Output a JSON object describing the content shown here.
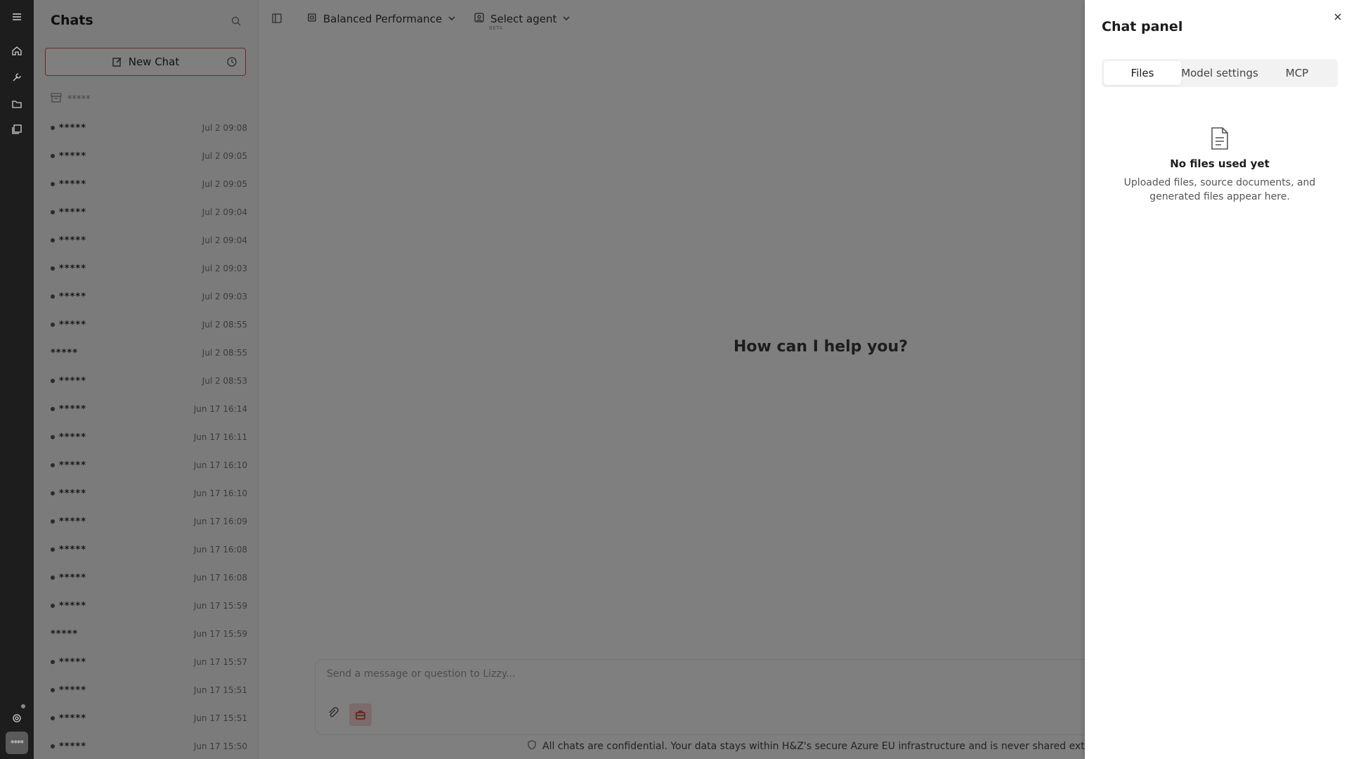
{
  "sidebar": {
    "title": "Chats",
    "new_chat_label": "New Chat",
    "archive_label": "*****",
    "chats": [
      {
        "name": "*****",
        "time": "Jul 2 09:08",
        "bullet": true
      },
      {
        "name": "*****",
        "time": "Jul 2 09:05",
        "bullet": true
      },
      {
        "name": "*****",
        "time": "Jul 2 09:05",
        "bullet": true
      },
      {
        "name": "*****",
        "time": "Jul 2 09:04",
        "bullet": true
      },
      {
        "name": "*****",
        "time": "Jul 2 09:04",
        "bullet": true
      },
      {
        "name": "*****",
        "time": "Jul 2 09:03",
        "bullet": true
      },
      {
        "name": "*****",
        "time": "Jul 2 09:03",
        "bullet": true
      },
      {
        "name": "*****",
        "time": "Jul 2 08:55",
        "bullet": true
      },
      {
        "name": "*****",
        "time": "Jul 2 08:55",
        "bullet": false
      },
      {
        "name": "*****",
        "time": "Jul 2 08:53",
        "bullet": true
      },
      {
        "name": "*****",
        "time": "Jun 17 16:14",
        "bullet": true
      },
      {
        "name": "*****",
        "time": "Jun 17 16:11",
        "bullet": true
      },
      {
        "name": "*****",
        "time": "Jun 17 16:10",
        "bullet": true
      },
      {
        "name": "*****",
        "time": "Jun 17 16:10",
        "bullet": true
      },
      {
        "name": "*****",
        "time": "Jun 17 16:09",
        "bullet": true
      },
      {
        "name": "*****",
        "time": "Jun 17 16:08",
        "bullet": true
      },
      {
        "name": "*****",
        "time": "Jun 17 16:08",
        "bullet": true
      },
      {
        "name": "*****",
        "time": "Jun 17 15:59",
        "bullet": true
      },
      {
        "name": "*****",
        "time": "Jun 17 15:59",
        "bullet": false
      },
      {
        "name": "*****",
        "time": "Jun 17 15:57",
        "bullet": true
      },
      {
        "name": "*****",
        "time": "Jun 17 15:51",
        "bullet": true
      },
      {
        "name": "*****",
        "time": "Jun 17 15:51",
        "bullet": true
      },
      {
        "name": "*****",
        "time": "Jun 17 15:50",
        "bullet": true
      }
    ]
  },
  "rail": {
    "icons": [
      "menu-icon",
      "home-icon",
      "wrench-icon",
      "folder-icon",
      "gallery-icon",
      "settings-icon"
    ],
    "avatar_label": "****"
  },
  "topbar": {
    "model_label": "Balanced Performance",
    "agent_label": "Select agent",
    "agent_badge": "BETA"
  },
  "main": {
    "hero": "How can I help you?",
    "composer_placeholder": "Send a message or question to Lizzy...",
    "footer_note": "All chats are confidential. Your data stays within H&Z's secure Azure EU infrastructure and is never shared externally."
  },
  "panel": {
    "title": "Chat panel",
    "tabs": [
      "Files",
      "Model settings",
      "MCP"
    ],
    "active_tab": "Files",
    "empty_title": "No files used yet",
    "empty_subtitle_line1": "Uploaded files, source documents, and",
    "empty_subtitle_line2": "generated files appear here."
  },
  "colors": {
    "accent": "#d9534f",
    "rail_bg": "#1d1d1d",
    "overlay": "rgba(0,0,0,0.5)"
  }
}
